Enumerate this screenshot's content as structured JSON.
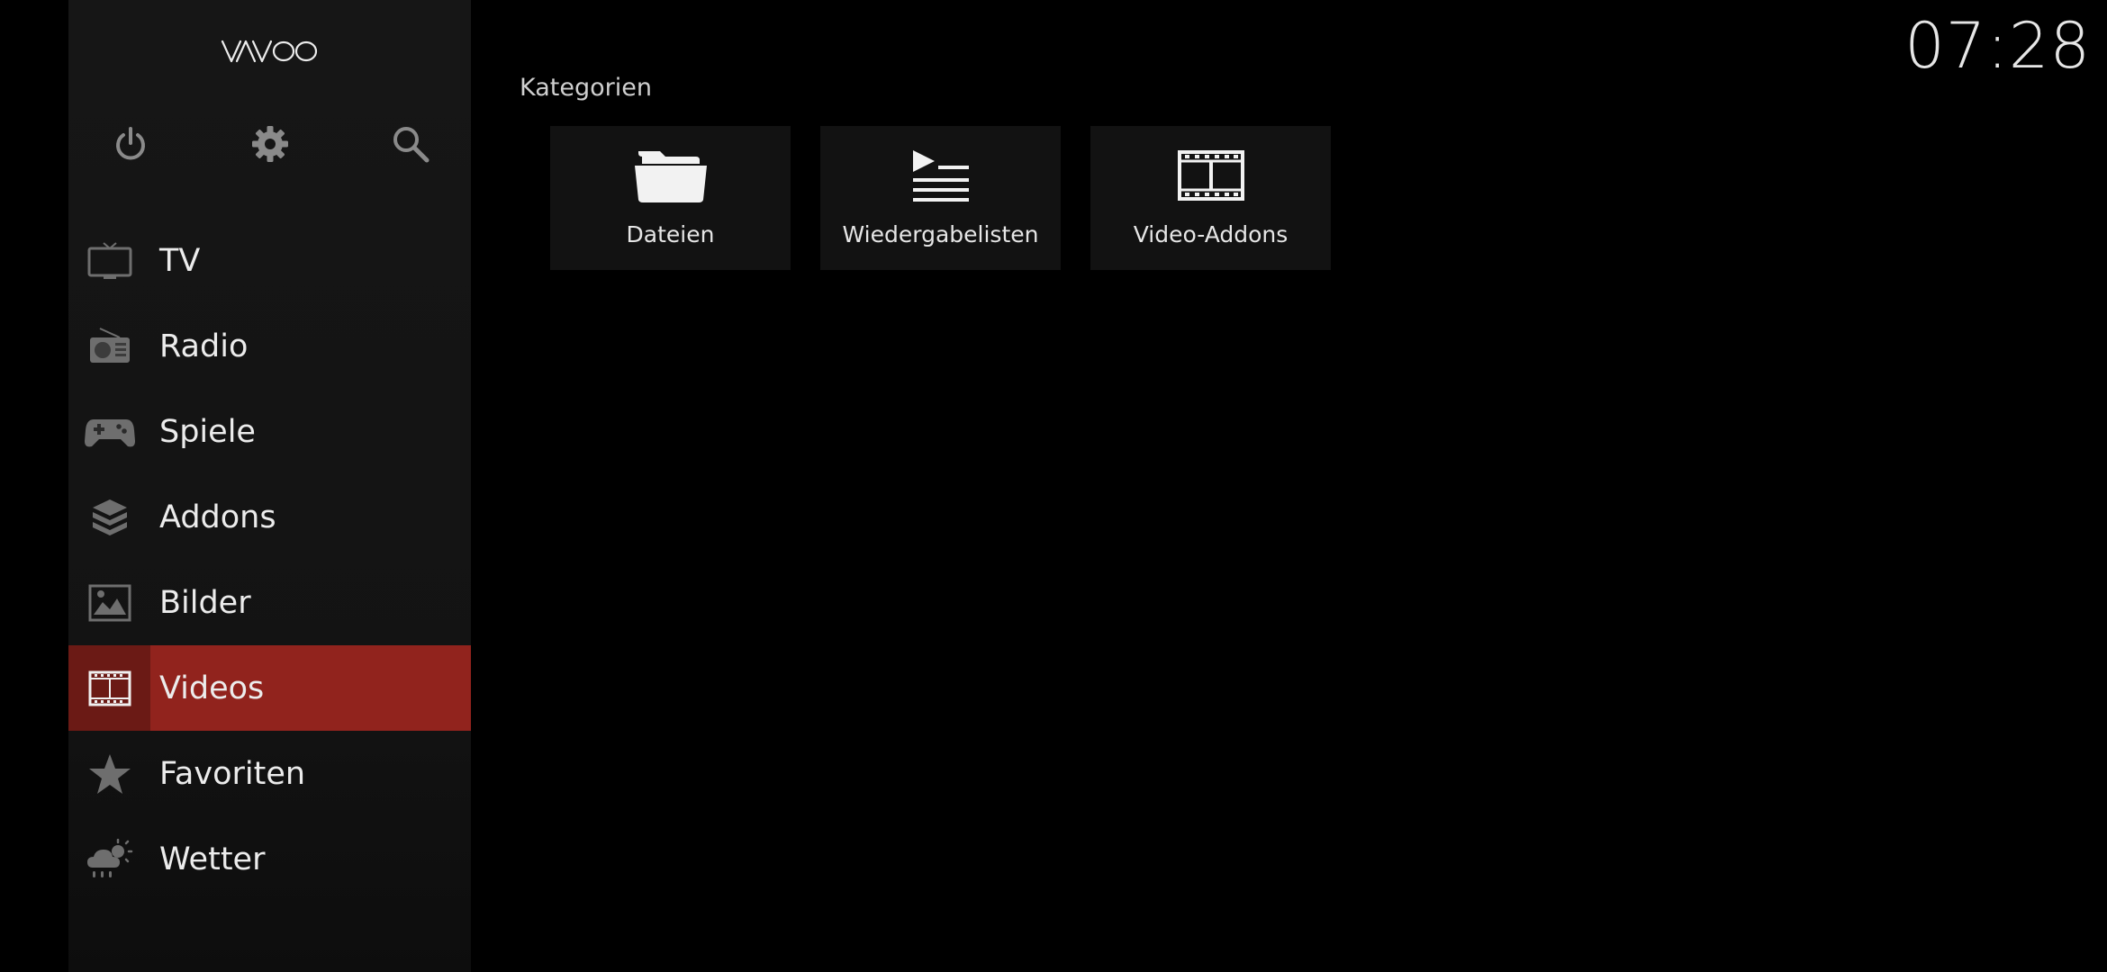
{
  "app": {
    "logo_text": "VAVOO",
    "clock": "07:28"
  },
  "top_icons": [
    {
      "name": "power-icon"
    },
    {
      "name": "gear-icon"
    },
    {
      "name": "search-icon"
    }
  ],
  "sidebar": {
    "items": [
      {
        "label": "TV",
        "icon": "tv-icon"
      },
      {
        "label": "Radio",
        "icon": "radio-icon"
      },
      {
        "label": "Spiele",
        "icon": "gamepad-icon"
      },
      {
        "label": "Addons",
        "icon": "box-icon"
      },
      {
        "label": "Bilder",
        "icon": "picture-icon"
      },
      {
        "label": "Videos",
        "icon": "film-icon",
        "active": true
      },
      {
        "label": "Favoriten",
        "icon": "star-icon"
      },
      {
        "label": "Wetter",
        "icon": "weather-icon"
      }
    ]
  },
  "main": {
    "section_title": "Kategorien",
    "tiles": [
      {
        "label": "Dateien",
        "icon": "folder-icon"
      },
      {
        "label": "Wiedergabelisten",
        "icon": "playlist-icon"
      },
      {
        "label": "Video-Addons",
        "icon": "film-icon"
      }
    ]
  },
  "colors": {
    "accent": "#91231d",
    "accent_dark": "#6b1a15",
    "sidebar_bg": "#161616",
    "tile_bg": "#121212",
    "icon_gray": "#8a8a8a"
  }
}
